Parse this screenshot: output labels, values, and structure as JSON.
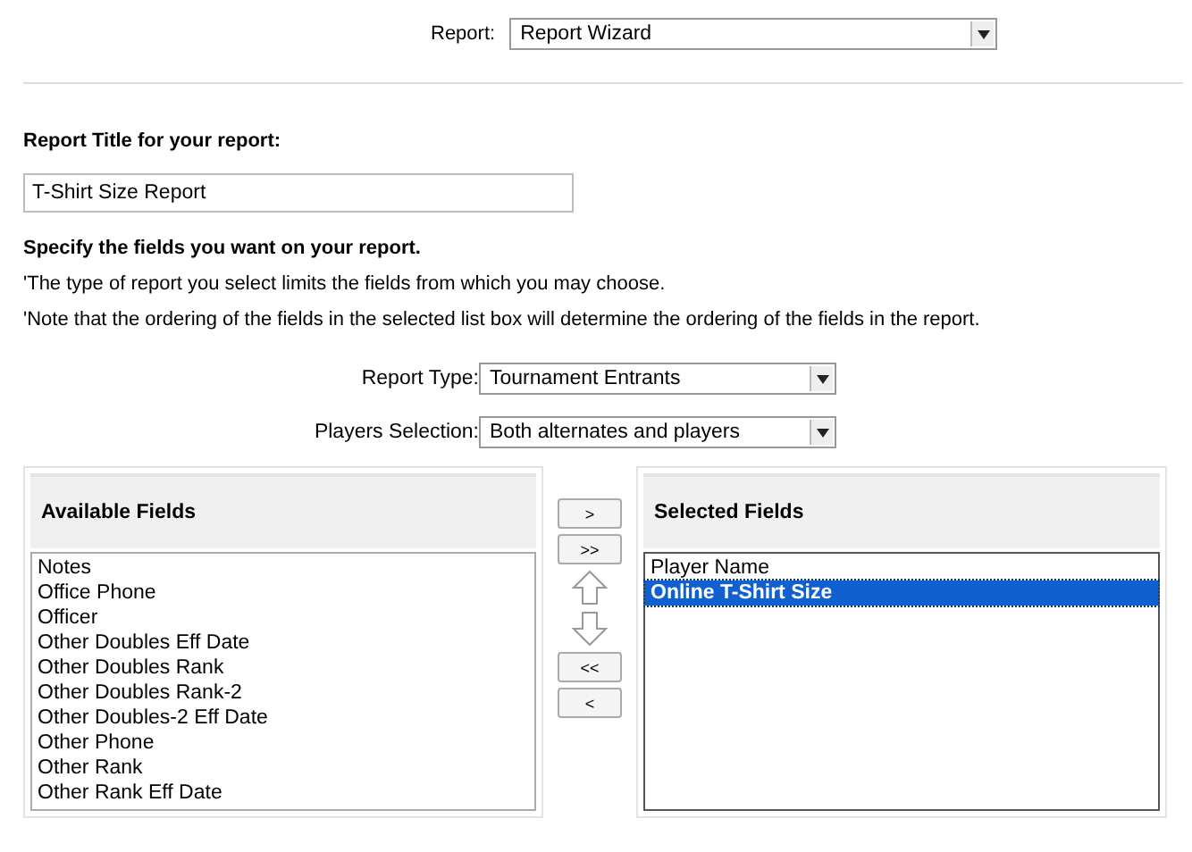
{
  "report": {
    "label": "Report:",
    "value": "Report Wizard"
  },
  "title_section": {
    "heading": "Report Title for your report:",
    "value": "T-Shirt Size Report"
  },
  "fields_section": {
    "heading": "Specify the fields you want on your report.",
    "notes": [
      "'The type of report you select limits the fields from which you may choose.",
      "'Note that the ordering of the fields in the selected list box will determine the ordering of the fields in the report."
    ]
  },
  "filters": [
    {
      "label": "Report Type:",
      "value": "Tournament Entrants"
    },
    {
      "label": "Players Selection:",
      "value": "Both alternates and players"
    }
  ],
  "available": {
    "heading": "Available Fields",
    "items": [
      {
        "label": "Notes",
        "selected": false
      },
      {
        "label": "Office Phone",
        "selected": false
      },
      {
        "label": "Officer",
        "selected": false
      },
      {
        "label": "Other Doubles Eff Date",
        "selected": false
      },
      {
        "label": "Other Doubles Rank",
        "selected": false
      },
      {
        "label": "Other Doubles Rank-2",
        "selected": false
      },
      {
        "label": "Other Doubles-2 Eff Date",
        "selected": false
      },
      {
        "label": "Other Phone",
        "selected": false
      },
      {
        "label": "Other Rank",
        "selected": false
      },
      {
        "label": "Other Rank Eff Date",
        "selected": false
      }
    ]
  },
  "move_buttons": {
    "top": [
      ">",
      ">>"
    ],
    "bottom": [
      "<<",
      "<"
    ]
  },
  "selected_list": {
    "heading": "Selected Fields",
    "items": [
      {
        "label": "Player Name",
        "selected": false
      },
      {
        "label": "Online T-Shirt Size",
        "selected": true
      }
    ]
  }
}
